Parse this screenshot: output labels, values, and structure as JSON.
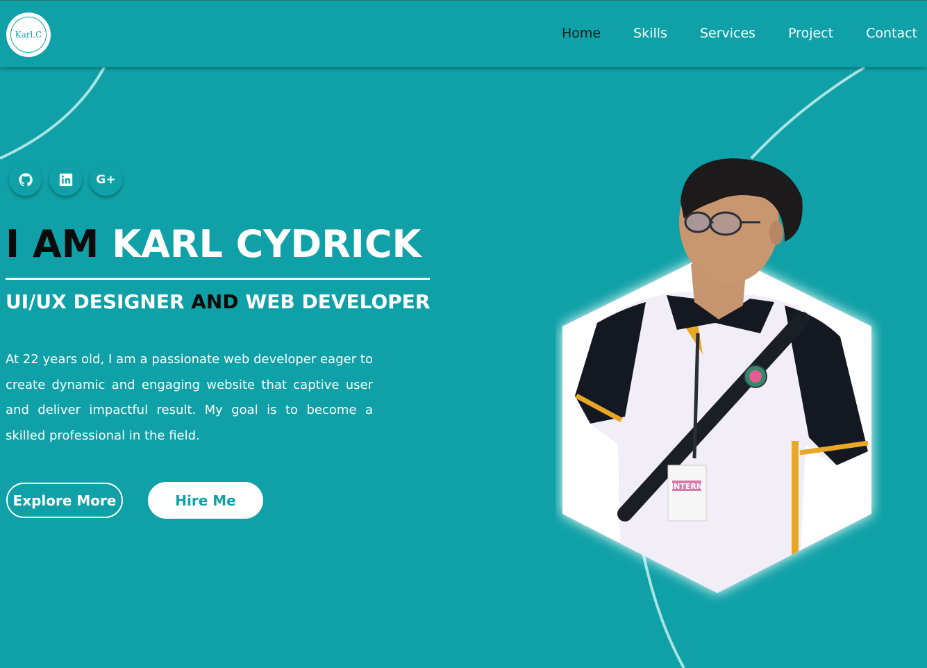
{
  "header": {
    "logo_text": "Karl.C",
    "nav": [
      {
        "label": "Home"
      },
      {
        "label": "Skills"
      },
      {
        "label": "Services"
      },
      {
        "label": "Project"
      },
      {
        "label": "Contact"
      }
    ]
  },
  "socials": [
    {
      "icon": "github-icon",
      "glyph": "◉"
    },
    {
      "icon": "linkedin-icon",
      "glyph": "in"
    },
    {
      "icon": "google-plus-icon",
      "glyph": "G+"
    }
  ],
  "hero": {
    "title_prefix": "I AM ",
    "title_name": "KARL CYDRICK",
    "subtitle_part1": "UI/UX DESIGNER ",
    "subtitle_and": "AND",
    "subtitle_part2": " WEB DEVELOPER",
    "bio": "At 22 years old, I am a passionate web developer eager to create dynamic and engaging website that captive user and deliver impactful result. My goal is to become a skilled professional in the field.",
    "explore_label": "Explore More",
    "hire_label": "Hire Me",
    "badge_text": "INTERN"
  },
  "colors": {
    "background": "#0fa1a7",
    "text_light": "#ffffff",
    "text_dark": "#0b0b0b",
    "accent_yellow": "#e8a825"
  }
}
